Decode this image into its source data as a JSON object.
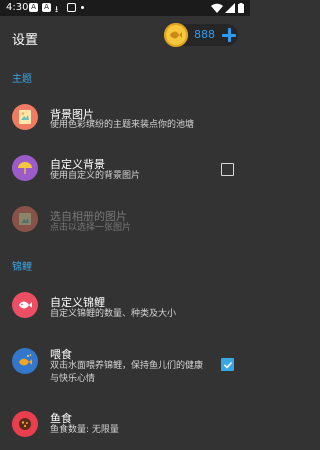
{
  "status_bar": {
    "time": "4:30"
  },
  "header": {
    "title": "设置",
    "coin_count": "888"
  },
  "sections": {
    "theme": "主题",
    "koi": "锦鲤"
  },
  "rows": {
    "background_image": {
      "title": "背景图片",
      "subtitle": "使用色彩缤纷的主题来装点你的池塘"
    },
    "custom_background": {
      "title": "自定义背景",
      "subtitle": "使用自定义的背景图片",
      "checked": false
    },
    "album_image": {
      "title": "选自相册的图片",
      "subtitle": "点击以选择一张图片"
    },
    "custom_koi": {
      "title": "自定义锦鲤",
      "subtitle": "自定义锦鲤的数量、种类及大小"
    },
    "feeding": {
      "title": "喂食",
      "subtitle": "双击水面喂养锦鲤，保持鱼儿们的健康与快乐心情",
      "checked": true
    },
    "fish_food": {
      "title": "鱼食",
      "subtitle": "鱼食数量: 无限量"
    }
  },
  "colors": {
    "accent": "#38a7e6",
    "coin_blue": "#2c9cf2",
    "background": "#333333",
    "icon_background_image": "#ee7b62",
    "icon_custom_background": "#9b5bc8",
    "icon_album": "#ee7b62",
    "icon_custom_koi": "#ec4f63",
    "icon_feeding": "#3277c9",
    "icon_fish_food": "#e83e4e"
  }
}
